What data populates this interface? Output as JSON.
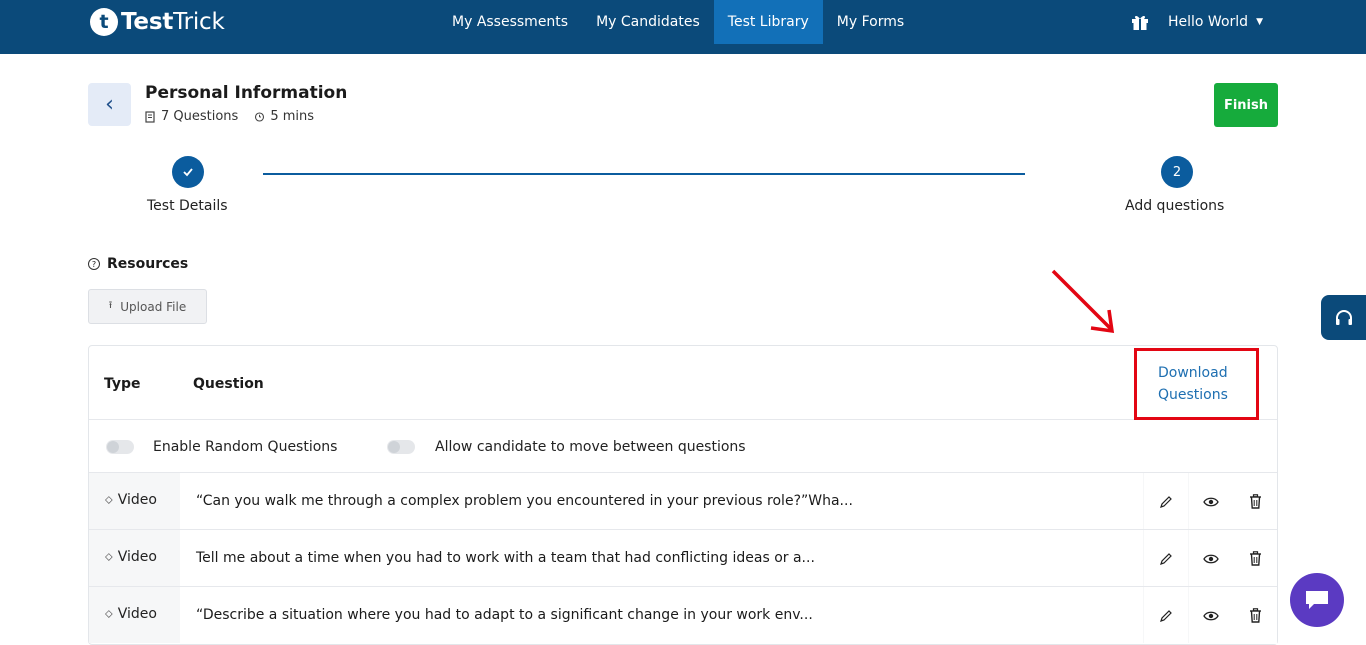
{
  "app": {
    "logo_mark": "t",
    "logo_bold": "Test",
    "logo_light": "Trick"
  },
  "nav": {
    "items": [
      {
        "label": "My Assessments"
      },
      {
        "label": "My Candidates"
      },
      {
        "label": "Test Library",
        "active": true
      },
      {
        "label": "My Forms"
      }
    ],
    "user_label": "Hello World",
    "caret": "▼"
  },
  "header": {
    "back_icon": "‹",
    "title": "Personal Information",
    "questions": "7 Questions",
    "duration": "5 mins",
    "finish_label": "Finish"
  },
  "stepper": {
    "step1_label": "Test Details",
    "step2_number": "2",
    "step2_label": "Add questions"
  },
  "resources": {
    "title": "Resources",
    "help_icon": "?",
    "upload_icon": "⭱",
    "upload_label": "Upload File"
  },
  "table": {
    "col_type": "Type",
    "col_question": "Question",
    "download_line1": "Download",
    "download_line2": "Questions",
    "random_label": "Enable Random Questions",
    "move_label": "Allow candidate to move between questions",
    "rows": [
      {
        "type": "Video",
        "question": "“Can you walk me through a complex problem you encountered in your previous role?”Wha..."
      },
      {
        "type": "Video",
        "question": "Tell me about a time when you had to work with a team that had conflicting ideas or a..."
      },
      {
        "type": "Video",
        "question": "“Describe a situation where you had to adapt to a significant change in your work env..."
      }
    ]
  },
  "colors": {
    "nav_bg": "#0b4a7a",
    "nav_active": "#1270b8",
    "finish_green": "#16ab3c",
    "step_blue": "#0b5c9e",
    "link_blue": "#1e6fb1",
    "annotation_red": "#e30613",
    "chat_purple": "#5b3ac2"
  }
}
